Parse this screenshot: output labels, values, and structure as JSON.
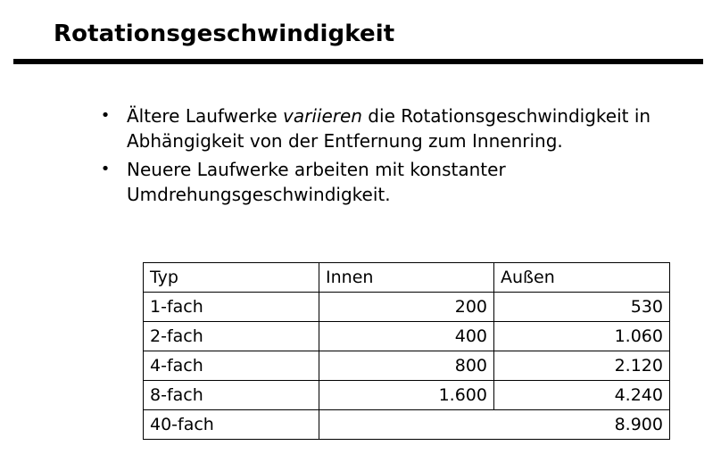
{
  "slide": {
    "title": "Rotationsgeschwindigkeit"
  },
  "bullets": [
    {
      "before": "Ältere Laufwerke ",
      "emphasis": "variieren",
      "after": " die Rotationsgeschwindigkeit in Abhängigkeit von der Entfernung zum Innenring."
    },
    {
      "text": "Neuere Laufwerke arbeiten mit konstanter Umdrehungsgeschwindigkeit."
    }
  ],
  "bullet_symbol": "•",
  "table": {
    "headers": [
      "Typ",
      "Innen",
      "Außen"
    ],
    "rows": [
      {
        "typ": "1-fach",
        "innen": "200",
        "aussen": "530"
      },
      {
        "typ": "2-fach",
        "innen": "400",
        "aussen": "1.060"
      },
      {
        "typ": "4-fach",
        "innen": "800",
        "aussen": "2.120"
      },
      {
        "typ": "8-fach",
        "innen": "1.600",
        "aussen": "4.240"
      }
    ],
    "last_row": {
      "typ": "40-fach",
      "merged_value": "8.900"
    }
  }
}
